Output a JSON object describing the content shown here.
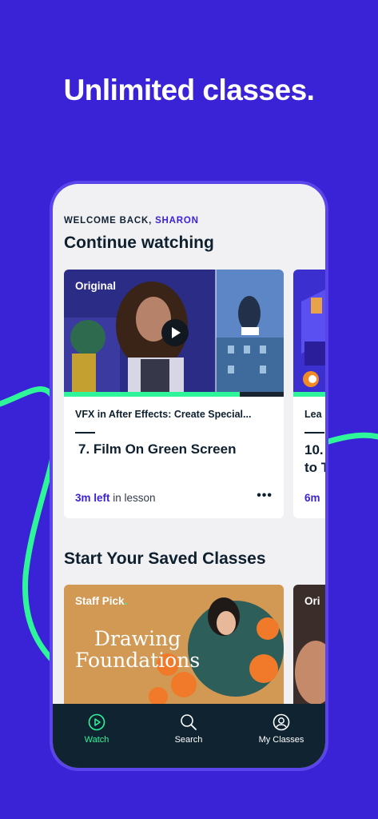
{
  "headline": "Unlimited classes.",
  "colors": {
    "brand": "#3a22d6",
    "accent": "#2ff59a",
    "tabbar": "#0f2430"
  },
  "welcome": {
    "prefix": "WELCOME BACK,",
    "name": "SHARON"
  },
  "continue_watching": {
    "title": "Continue watching",
    "cards": [
      {
        "badge": "Original",
        "course": "VFX in After Effects: Create Special...",
        "lesson": "7. Film On Green Screen",
        "time_left": "3m left",
        "time_suffix": "in lesson",
        "progress": 0.8
      },
      {
        "course": "Lea",
        "lesson_line1": "10.",
        "lesson_line2": "to T",
        "time_left": "6m"
      }
    ]
  },
  "saved_classes": {
    "title": "Start Your Saved Classes",
    "cards": [
      {
        "badge": "Staff Pick",
        "badge_dot": ".",
        "art_title_line1": "Drawing",
        "art_title_line2": "Foundations"
      },
      {
        "badge": "Ori"
      }
    ]
  },
  "tabs": [
    {
      "label": "Watch",
      "icon": "play-circle-icon",
      "active": true
    },
    {
      "label": "Search",
      "icon": "search-icon",
      "active": false
    },
    {
      "label": "My Classes",
      "icon": "user-circle-icon",
      "active": false
    }
  ]
}
